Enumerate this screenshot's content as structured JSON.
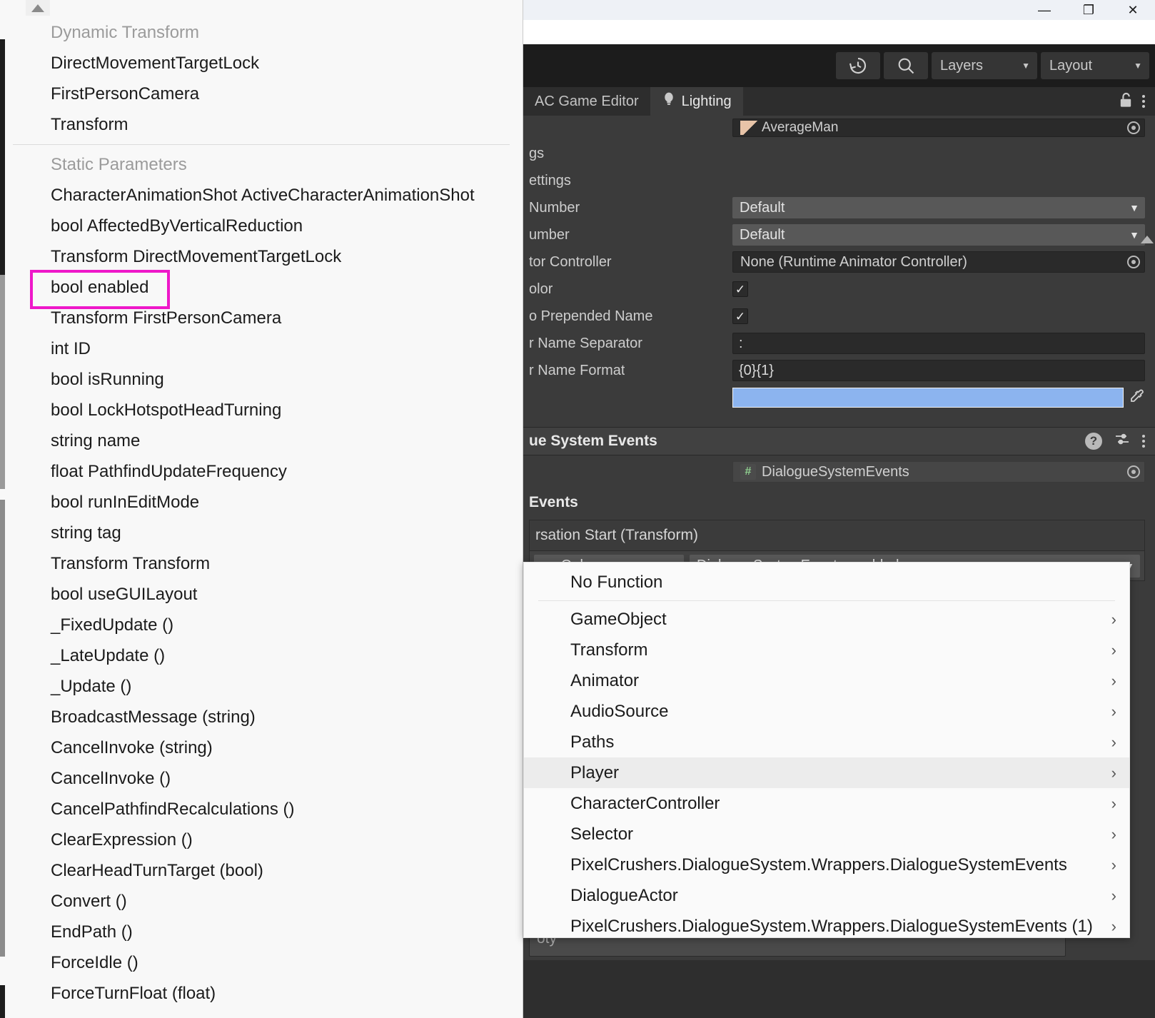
{
  "window": {
    "minimize_label": "—",
    "restore_label": "❐",
    "close_label": "✕"
  },
  "toolbar": {
    "history_icon": "history-icon",
    "search_icon": "search-icon",
    "layers_label": "Layers",
    "layout_label": "Layout",
    "caret": "▼"
  },
  "tabs": [
    {
      "label": "AC Game Editor",
      "icon": ""
    },
    {
      "label": "Lighting",
      "icon": "lightbulb-icon"
    }
  ],
  "inspector": {
    "lock_icon": "unlock-icon",
    "kebab_icon": "more-options-icon",
    "object_field_value": "AverageMan",
    "rows": [
      {
        "label": "gs",
        "type": "header-partial"
      },
      {
        "label": "ettings",
        "type": "header-partial"
      },
      {
        "label": " Number",
        "type": "dropdown",
        "value": "Default"
      },
      {
        "label": "umber",
        "type": "dropdown",
        "value": "Default"
      },
      {
        "label": "tor Controller",
        "type": "object",
        "value": "None (Runtime Animator Controller)"
      },
      {
        "label": "olor",
        "type": "checkbox",
        "value": "✓"
      },
      {
        "label": "o Prepended Name",
        "type": "checkbox",
        "value": "✓"
      },
      {
        "label": "r Name Separator",
        "type": "text",
        "value": ":"
      },
      {
        "label": "r Name Format",
        "type": "text",
        "value": "{0}{1}"
      },
      {
        "label": "",
        "type": "color",
        "value": "#8cb4ef"
      }
    ]
  },
  "events_component": {
    "section_title": "ue System Events",
    "help_icon": "help-icon",
    "preset_icon": "preset-icon",
    "kebab_icon": "more-options-icon",
    "script_field_value": "DialogueSystemEvents",
    "script_icon": "script-icon",
    "subsection_title": " Events",
    "event_title": "rsation Start (Transform)",
    "listener_mode": "ne Only",
    "listener_function": "DialogueSystemEvents.enabled",
    "caret": "▼",
    "empty_text": "oty",
    "add_label": "+",
    "remove_label": "−"
  },
  "picker_panel": {
    "scroll_up_icon": "scroll-up-arrow-icon",
    "groups": [
      {
        "title": "Dynamic Transform",
        "items": [
          "DirectMovementTargetLock",
          "FirstPersonCamera",
          "Transform"
        ]
      },
      {
        "title": "Static Parameters",
        "items": [
          "CharacterAnimationShot ActiveCharacterAnimationShot",
          "bool AffectedByVerticalReduction",
          "Transform DirectMovementTargetLock",
          "bool enabled",
          "Transform FirstPersonCamera",
          "int ID",
          "bool isRunning",
          "bool LockHotspotHeadTurning",
          "string name",
          "float PathfindUpdateFrequency",
          "bool runInEditMode",
          "string tag",
          "Transform Transform",
          "bool useGUILayout",
          "_FixedUpdate ()",
          "_LateUpdate ()",
          "_Update ()",
          "BroadcastMessage (string)",
          "CancelInvoke (string)",
          "CancelInvoke ()",
          "CancelPathfindRecalculations ()",
          "ClearExpression ()",
          "ClearHeadTurnTarget (bool)",
          "Convert ()",
          "EndPath ()",
          "ForceIdle ()",
          "ForceTurnFloat (float)"
        ]
      }
    ],
    "highlighted_item": "bool enabled",
    "highlight_color": "#ee18c9"
  },
  "function_menu": {
    "no_function_label": "No Function",
    "highlighted_item": "Player",
    "chevron": "›",
    "items": [
      "GameObject",
      "Transform",
      "Animator",
      "AudioSource",
      "Paths",
      "Player",
      "CharacterController",
      "Selector",
      "PixelCrushers.DialogueSystem.Wrappers.DialogueSystemEvents",
      "DialogueActor",
      "PixelCrushers.DialogueSystem.Wrappers.DialogueSystemEvents (1)"
    ]
  }
}
